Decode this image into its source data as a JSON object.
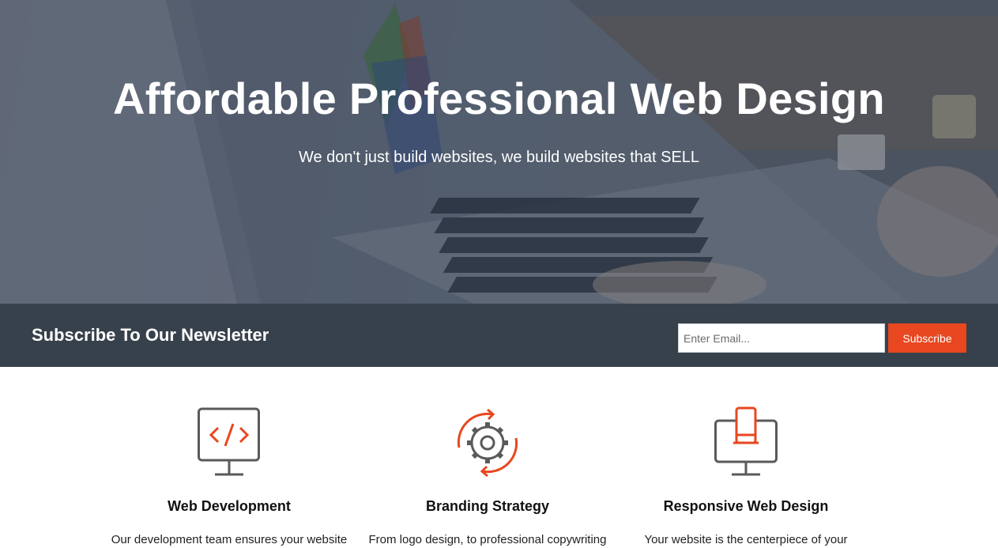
{
  "hero": {
    "title": "Affordable Professional Web Design",
    "subtitle": "We don't just build websites, we build websites that SELL"
  },
  "newsletter": {
    "title": "Subscribe To Our Newsletter",
    "email_placeholder": "Enter Email...",
    "button_label": "Subscribe"
  },
  "services": [
    {
      "icon": "code-monitor-icon",
      "title": "Web Development",
      "text": "Our development team ensures your website"
    },
    {
      "icon": "gear-sync-icon",
      "title": "Branding Strategy",
      "text": "From logo design, to professional copywriting"
    },
    {
      "icon": "responsive-devices-icon",
      "title": "Responsive Web Design",
      "text": "Your website is the centerpiece of your"
    }
  ],
  "colors": {
    "accent": "#e8471f",
    "newsletter_bg": "#37414b",
    "icon_gray": "#5a5a5a"
  }
}
